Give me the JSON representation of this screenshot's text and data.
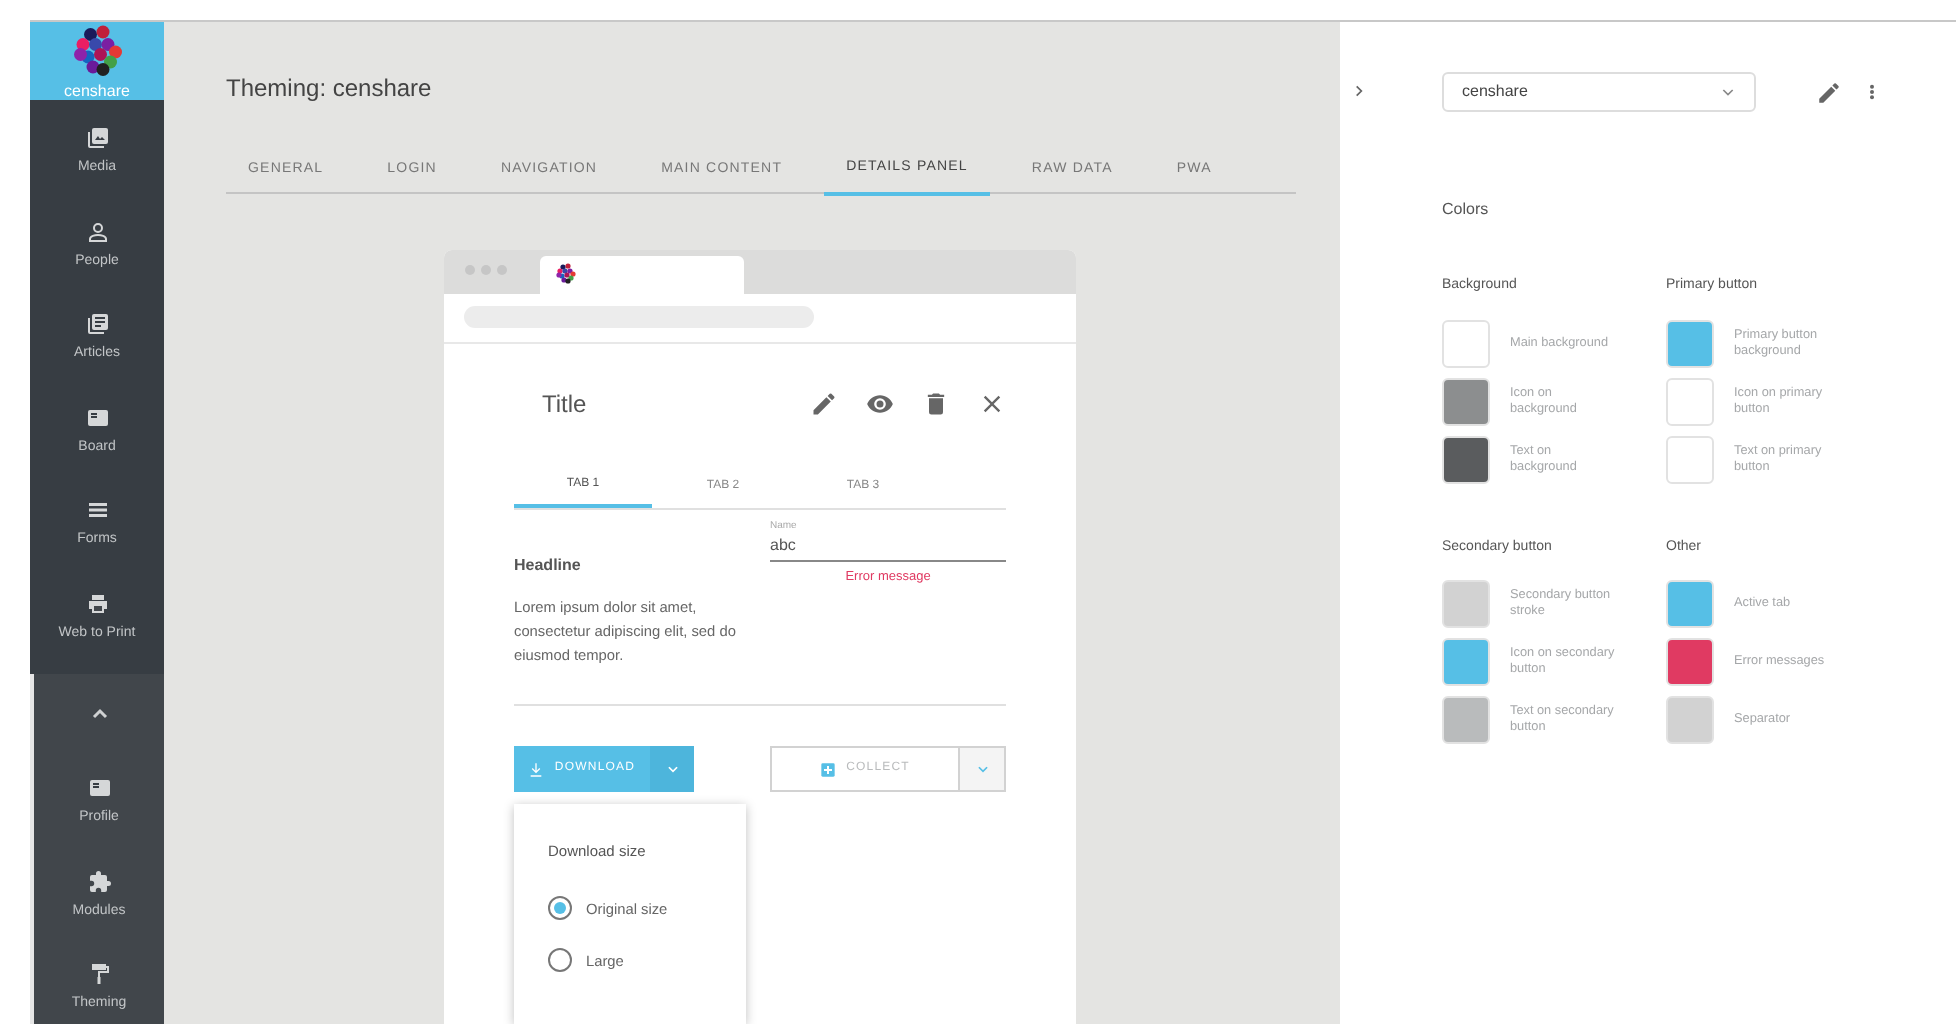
{
  "sidebar": {
    "logo": "censhare",
    "items": [
      {
        "label": "Media"
      },
      {
        "label": "People"
      },
      {
        "label": "Articles"
      },
      {
        "label": "Board"
      },
      {
        "label": "Forms"
      },
      {
        "label": "Web to Print"
      }
    ],
    "lower_items": [
      {
        "label": "Profile"
      },
      {
        "label": "Modules"
      },
      {
        "label": "Theming"
      }
    ]
  },
  "header": {
    "title": "Theming: censhare"
  },
  "tabs": [
    {
      "label": "GENERAL",
      "selected": false
    },
    {
      "label": "LOGIN",
      "selected": false
    },
    {
      "label": "NAVIGATION",
      "selected": false
    },
    {
      "label": "MAIN CONTENT",
      "selected": false
    },
    {
      "label": "DETAILS PANEL",
      "selected": true
    },
    {
      "label": "RAW DATA",
      "selected": false
    },
    {
      "label": "PWA",
      "selected": false
    }
  ],
  "preview": {
    "title": "Title",
    "tabs": [
      {
        "label": "TAB 1",
        "selected": true
      },
      {
        "label": "TAB 2",
        "selected": false
      },
      {
        "label": "TAB 3",
        "selected": false
      }
    ],
    "headline": "Headline",
    "body": "Lorem ipsum dolor sit amet, consectetur adipiscing elit, sed do eiusmod tempor.",
    "field": {
      "label": "Name",
      "value": "abc",
      "error": "Error message"
    },
    "download_button": "DOWNLOAD",
    "collect_button": "COLLECT",
    "menu": {
      "title": "Download size",
      "options": [
        {
          "label": "Original size",
          "selected": true
        },
        {
          "label": "Large",
          "selected": false
        }
      ]
    }
  },
  "panel": {
    "theme_select": "censhare",
    "heading": "Colors",
    "groups": [
      {
        "title": "Background",
        "swatches": [
          {
            "label": "Main background",
            "color": "#ffffff"
          },
          {
            "label": "Icon on background",
            "color": "#8c8e8f"
          },
          {
            "label": "Text on background",
            "color": "#5a5c5e"
          }
        ]
      },
      {
        "title": "Primary button",
        "swatches": [
          {
            "label": "Primary button background",
            "color": "#56bfe6"
          },
          {
            "label": "Icon on primary button",
            "color": "#ffffff"
          },
          {
            "label": "Text on primary button",
            "color": "#ffffff"
          }
        ]
      },
      {
        "title": "Secondary button",
        "swatches": [
          {
            "label": "Secondary button stroke",
            "color": "#d2d2d2"
          },
          {
            "label": "Icon on secondary button",
            "color": "#56bfe6"
          },
          {
            "label": "Text on secondary button",
            "color": "#b9bbbc"
          }
        ]
      },
      {
        "title": "Other",
        "swatches": [
          {
            "label": "Active tab",
            "color": "#56bfe6"
          },
          {
            "label": "Error messages",
            "color": "#e03a62"
          },
          {
            "label": "Separator",
            "color": "#d2d2d2"
          }
        ]
      }
    ]
  }
}
